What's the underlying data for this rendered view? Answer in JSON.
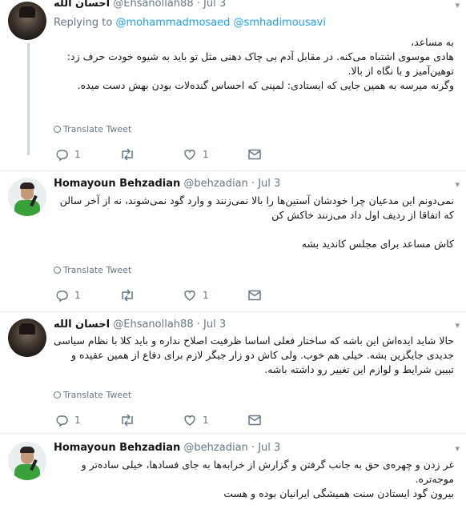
{
  "tweets": [
    {
      "author": {
        "name": "احسان الله",
        "handle": "@Ehsanollah88",
        "date": "Jul 3"
      },
      "replying_label": "Replying to",
      "replying_to": "@mohammadmosaed @smhadimousavi",
      "body": [
        "به مساعد،",
        "هادی موسوی اشتباه می‌کنه. در مقابل آدم بی چاک دهنی مثل تو باید به شیوه خودت حرف زد: توهین‌آمیز و با نگاه از بالا.",
        "وگرنه میرسه به همین جایی که ایستادی: لمپنی که احساس گنده‌لات بودن بهش دست میده."
      ],
      "translate": "Translate Tweet",
      "counts": {
        "reply": "1",
        "retweet": "",
        "like": "1"
      }
    },
    {
      "author": {
        "name": "Homayoun Behzadian",
        "handle": "@behzadian",
        "date": "Jul 3"
      },
      "body": [
        "نمی‌دونم این مدعیان چرا خودشان آستین‌ها را بالا نمی‌زنند و وارد گود نمی‌شوند، نه از آخر سالن که اتفاقا از ردیف اول داد می‌زنند خاکش کن",
        "",
        "کاش مساعد برای مجلس کاندید بشه"
      ],
      "translate": "Translate Tweet",
      "counts": {
        "reply": "1",
        "retweet": "",
        "like": "1"
      }
    },
    {
      "author": {
        "name": "احسان الله",
        "handle": "@Ehsanollah88",
        "date": "Jul 3"
      },
      "body": [
        "حالا شاید ایده‌اش این باشه که ساختار فعلی اساسا ظرفیت اصلاح نداره و باید کلا با نظام سیاسی جدیدی جایگزین بشه. خیلی هم خوب. ولی کاش دو زار جیگر لازم برای دفاع از همین عقیده و تبیین شرایط و لوازم این تغییر رو داشته باشه."
      ],
      "translate": "Translate Tweet",
      "counts": {
        "reply": "1",
        "retweet": "",
        "like": "1"
      }
    },
    {
      "author": {
        "name": "Homayoun Behzadian",
        "handle": "@behzadian",
        "date": "Jul 3"
      },
      "body": [
        "غر زدن و چهره‌ی حق به جانب گرفتن و گزارش از خرابه‌ها به جای فسادها، خیلی ساده‌تر و موجه‌تره.",
        "بیرون گود ایستادن سنت همیشگی ایرانیان بوده و هست"
      ]
    }
  ],
  "icons": {
    "reply": "reply-icon",
    "retweet": "retweet-icon",
    "like": "heart-icon",
    "dm": "message-icon",
    "caret": "chevron-down-icon",
    "translate": "globe-icon"
  },
  "colors": {
    "link": "#1da1f2",
    "meta": "#657786",
    "thread_line": "#ccd6dd"
  }
}
